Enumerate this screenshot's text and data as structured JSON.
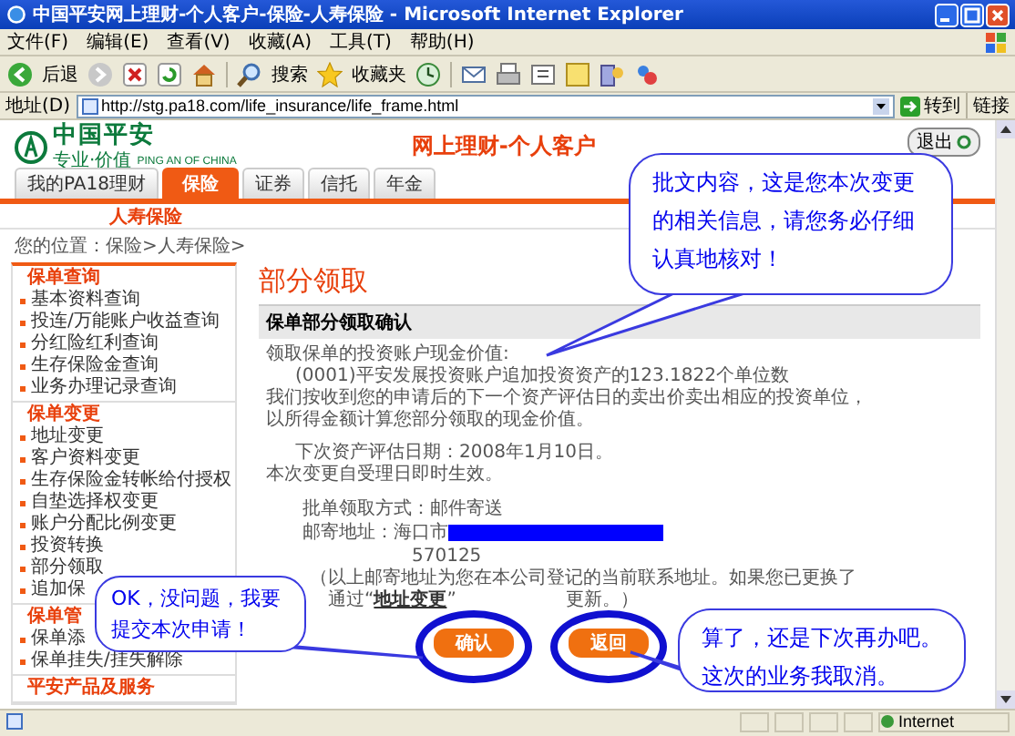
{
  "window": {
    "title": "中国平安网上理财-个人客户-保险-人寿保险 - Microsoft Internet Explorer"
  },
  "menu": [
    "文件(F)",
    "编辑(E)",
    "查看(V)",
    "收藏(A)",
    "工具(T)",
    "帮助(H)"
  ],
  "toolbar": {
    "back": "后退",
    "search": "搜索",
    "favorites": "收藏夹"
  },
  "address_bar": {
    "label": "地址(D)",
    "url": "http://stg.pa18.com/life_insurance/life_frame.html",
    "go": "转到",
    "links": "链接"
  },
  "site": {
    "logo_cn": "中国平安",
    "logo_tagline": "专业·价值",
    "logo_en": "PING AN OF CHINA",
    "heading": "网上理财-个人客户",
    "logout": "退出",
    "tabs": [
      {
        "label": "我的PA18理财",
        "selected": false
      },
      {
        "label": "保险",
        "selected": true
      },
      {
        "label": "证券",
        "selected": false
      },
      {
        "label": "信托",
        "selected": false
      },
      {
        "label": "年金",
        "selected": false
      }
    ],
    "subnav": "人寿保险",
    "breadcrumb": "您的位置：保险>人寿保险>"
  },
  "sidebar": {
    "sections": [
      {
        "title": "保单查询",
        "items": [
          "基本资料查询",
          "投连/万能账户收益查询",
          "分红险红利查询",
          "生存保险金查询",
          "业务办理记录查询"
        ]
      },
      {
        "title": "保单变更",
        "items": [
          "地址变更",
          "客户资料变更",
          "生存保险金转帐给付授权",
          "自垫选择权变更",
          "账户分配比例变更",
          "投资转换",
          "部分领取",
          "追加保"
        ]
      },
      {
        "title": "保单管",
        "items": [
          "保单添",
          "保单挂失/挂失解除"
        ]
      },
      {
        "title": "平安产品及服务"
      }
    ]
  },
  "main": {
    "title": "部分领取",
    "panel_title": "保单部分领取确认",
    "paragraphs": [
      [
        {
          "text": "领取保单的投资账户现金价值:",
          "indent": false
        },
        {
          "text": "(0001)平安发展投资账户追加投资资产的123.1822个单位数",
          "indent": true
        },
        {
          "text": "我们按收到您的申请后的下一个资产评估日的卖出价卖出相应的投资单位，",
          "indent": false
        },
        {
          "text": "以所得金额计算您部分领取的现金价值。",
          "indent": false
        }
      ],
      [
        {
          "text": "下次资产评估日期：2008年1月10日。",
          "indent": true
        },
        {
          "text": "本次变更自受理日即时生效。",
          "indent": false
        }
      ]
    ],
    "fields": [
      {
        "label": "批单领取方式：",
        "value": "邮件寄送",
        "redacted": false
      },
      {
        "label": "邮寄地址：",
        "value": "海口市",
        "redacted": true
      },
      {
        "value": "570125",
        "redacted": false
      }
    ],
    "note": {
      "line_1": "（以上邮寄地址为您在本公司登记的当前联系地址。如果您已更换了",
      "line_2_start": "通过“",
      "link": "地址变更",
      "line_2_mid": "”",
      "line_2_end": "更新。）"
    },
    "buttons": [
      "确认",
      "返回"
    ]
  },
  "callouts": [
    {
      "text": "批文内容，这是您本次变更的相关信息，请您务必仔细认真地核对！"
    },
    {
      "text": "OK，没问题，我要提交本次申请！"
    },
    {
      "text": "算了，还是下次再办吧。这次的业务我取消。"
    }
  ],
  "status_bar": {
    "zone": "Internet"
  }
}
